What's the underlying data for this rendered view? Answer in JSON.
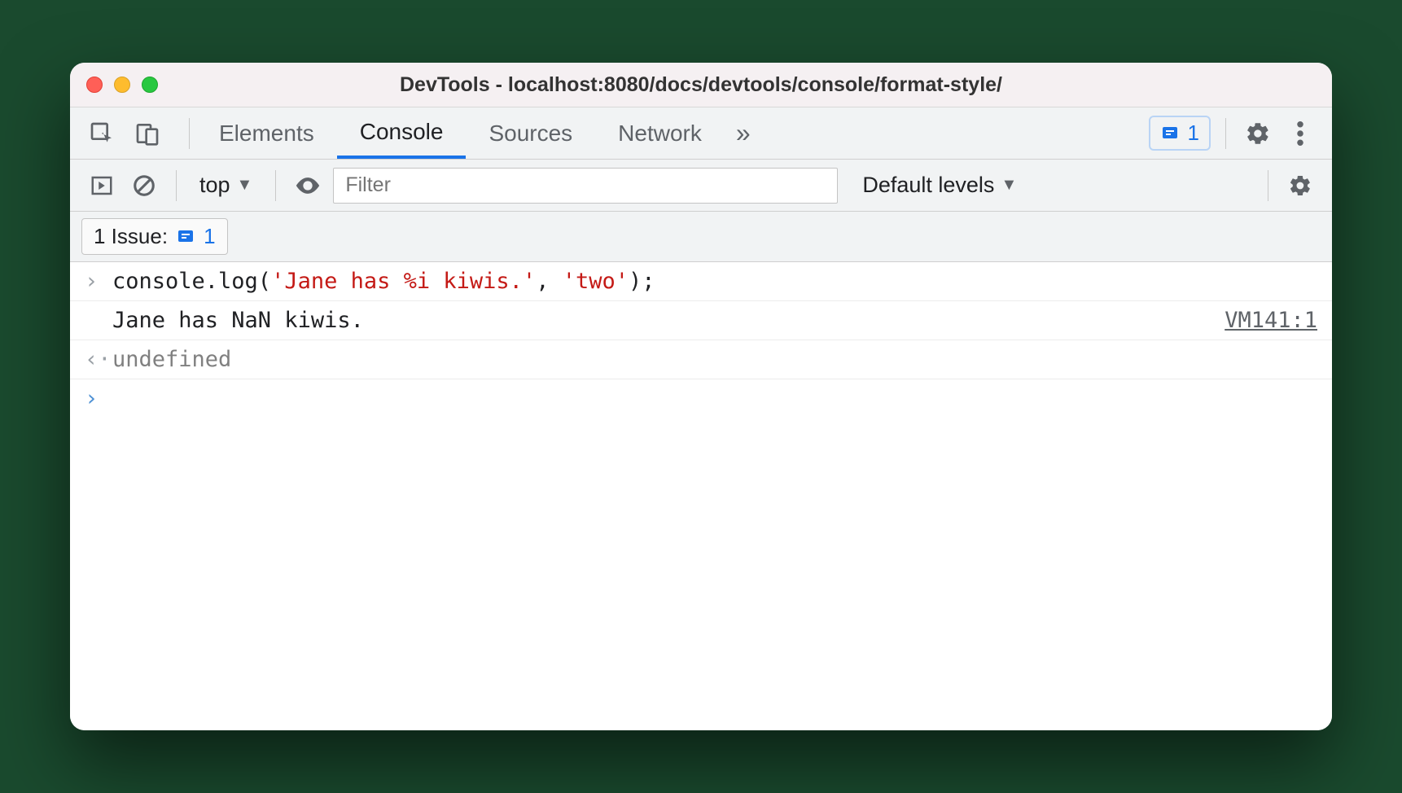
{
  "window": {
    "title": "DevTools - localhost:8080/docs/devtools/console/format-style/"
  },
  "tabs": {
    "items": [
      "Elements",
      "Console",
      "Sources",
      "Network"
    ],
    "active_index": 1,
    "overflow_glyph": "»"
  },
  "toolbar": {
    "issues_count": "1"
  },
  "subbar": {
    "context": "top",
    "filter_placeholder": "Filter",
    "levels_label": "Default levels"
  },
  "issues_chip": {
    "label": "1 Issue:",
    "count": "1"
  },
  "console": {
    "input_prefix": "console.log(",
    "input_arg1": "'Jane has %i kiwis.'",
    "input_sep": ", ",
    "input_arg2": "'two'",
    "input_suffix": ");",
    "output_text": "Jane has NaN kiwis.",
    "output_source": "VM141:1",
    "return_value": "undefined"
  }
}
